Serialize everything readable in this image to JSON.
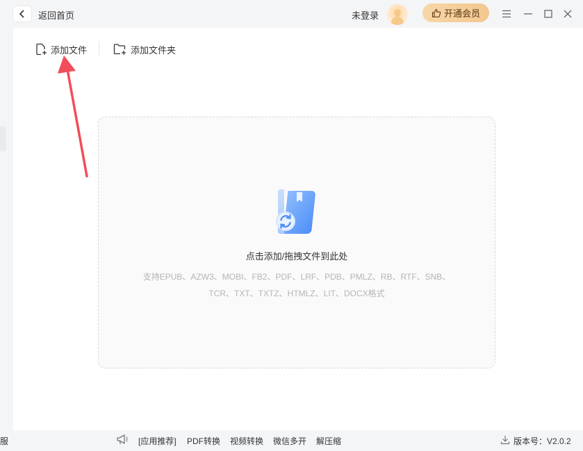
{
  "titlebar": {
    "back_label": "返回首页",
    "login_text": "未登录",
    "vip_label": "开通会员"
  },
  "toolbar": {
    "add_file_label": "添加文件",
    "add_folder_label": "添加文件夹"
  },
  "dropzone": {
    "title": "点击添加/拖拽文件到此处",
    "formats_line1": "支持EPUB、AZW3、MOBI、FB2、PDF、LRF、PDB、PMLZ、RB、RTF、SNB、",
    "formats_line2": "TCR、TXT、TXTZ、HTMLZ、LIT、DOCX格式"
  },
  "statusbar": {
    "left_fragment": "服",
    "links": [
      "[应用推荐]",
      "PDF转换",
      "视频转换",
      "微信多开",
      "解压缩"
    ],
    "version_label": "版本号：V2.0.2"
  },
  "colors": {
    "accent_arrow": "#f24d5a",
    "vip_gradient": "#f3c78f",
    "book_blue": "#4d8ef8"
  },
  "icons": {
    "back": "chevron-left-icon",
    "menu": "hamburger-icon",
    "minimize": "minimize-icon",
    "maximize": "maximize-icon",
    "close": "close-icon",
    "add_file": "file-plus-icon",
    "add_folder": "folder-plus-icon",
    "book": "book-convert-icon",
    "megaphone": "megaphone-icon",
    "download": "download-icon"
  }
}
